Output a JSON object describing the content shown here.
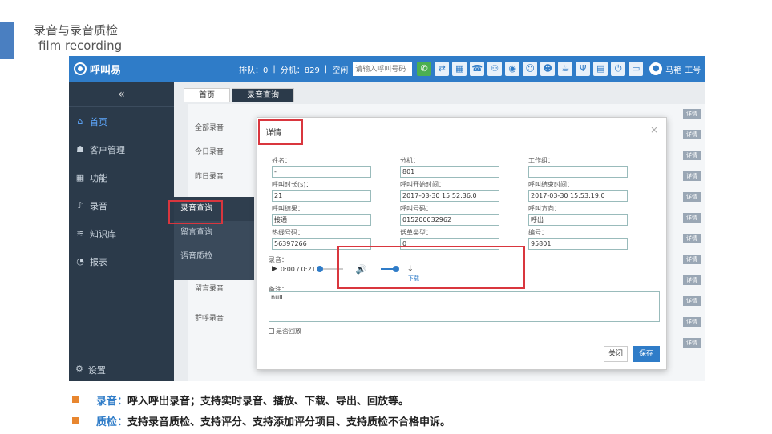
{
  "slide": {
    "title": "录音与录音质检",
    "subtitle": "film recording"
  },
  "app": {
    "name": "呼叫易",
    "queue": "排队：0",
    "extension": "分机：829",
    "state": "空闲",
    "search_placeholder": "请输入呼叫号码",
    "user_name": "马艳",
    "user_suffix": "工号"
  },
  "sidebar": {
    "collapse_label": "«",
    "items": [
      {
        "label": "首页",
        "icon": "home-icon",
        "glyph": "⌂"
      },
      {
        "label": "客户管理",
        "icon": "users-icon",
        "glyph": "☗"
      },
      {
        "label": "功能",
        "icon": "grid-icon",
        "glyph": "▦"
      },
      {
        "label": "录音",
        "icon": "mic-icon",
        "glyph": "♪"
      },
      {
        "label": "知识库",
        "icon": "layers-icon",
        "glyph": "≋"
      },
      {
        "label": "报表",
        "icon": "pie-chart-icon",
        "glyph": "◔"
      }
    ],
    "settings_label": "设置",
    "settings_icon": "gear-icon"
  },
  "submenu": {
    "items": [
      "录音查询",
      "留言查询",
      "语音质检"
    ]
  },
  "tabs": [
    "首页",
    "录音查询"
  ],
  "background_rows": [
    "全部录音",
    "今日录音",
    "昨日录音",
    "留言录音",
    "群呼录音"
  ],
  "detail_button_label": "详情",
  "modal": {
    "title": "详情",
    "close_glyph": "×",
    "fields": [
      {
        "label": "姓名：",
        "value": "-"
      },
      {
        "label": "分机：",
        "value": "801"
      },
      {
        "label": "工作组：",
        "value": ""
      },
      {
        "label": "呼叫时长(s)：",
        "value": "21"
      },
      {
        "label": "呼叫开始时间：",
        "value": "2017-03-30 15:52:36.0"
      },
      {
        "label": "呼叫结束时间：",
        "value": "2017-03-30 15:53:19.0"
      },
      {
        "label": "呼叫结果：",
        "value": "接通"
      },
      {
        "label": "呼叫号码：",
        "value": "015200032962"
      },
      {
        "label": "呼叫方向：",
        "value": "呼出"
      },
      {
        "label": "热线号码：",
        "value": "56397266"
      },
      {
        "label": "话单类型：",
        "value": "0"
      },
      {
        "label": "编号：",
        "value": "95801"
      }
    ],
    "audio_label": "录音：",
    "audio_time": "0:00 / 0:21",
    "audio_progress": 0,
    "download_label": "下载",
    "remark_label": "备注：",
    "remark_value": "null",
    "checkbox_label": "是否回放",
    "close_button": "关闭",
    "save_button": "保存"
  },
  "bullets": [
    {
      "key": "录音：",
      "text": "呼入呼出录音；支持实时录音、播放、下载、导出、回放等。"
    },
    {
      "key": "质检：",
      "text": "支持录音质检、支持评分、支持添加评分项目、支持质检不合格申诉。"
    }
  ],
  "colors": {
    "brand_blue": "#2f7cc8",
    "sidebar_bg": "#2b3a4a",
    "highlight_red": "#d9363e",
    "bullet_orange": "#e8862f"
  }
}
